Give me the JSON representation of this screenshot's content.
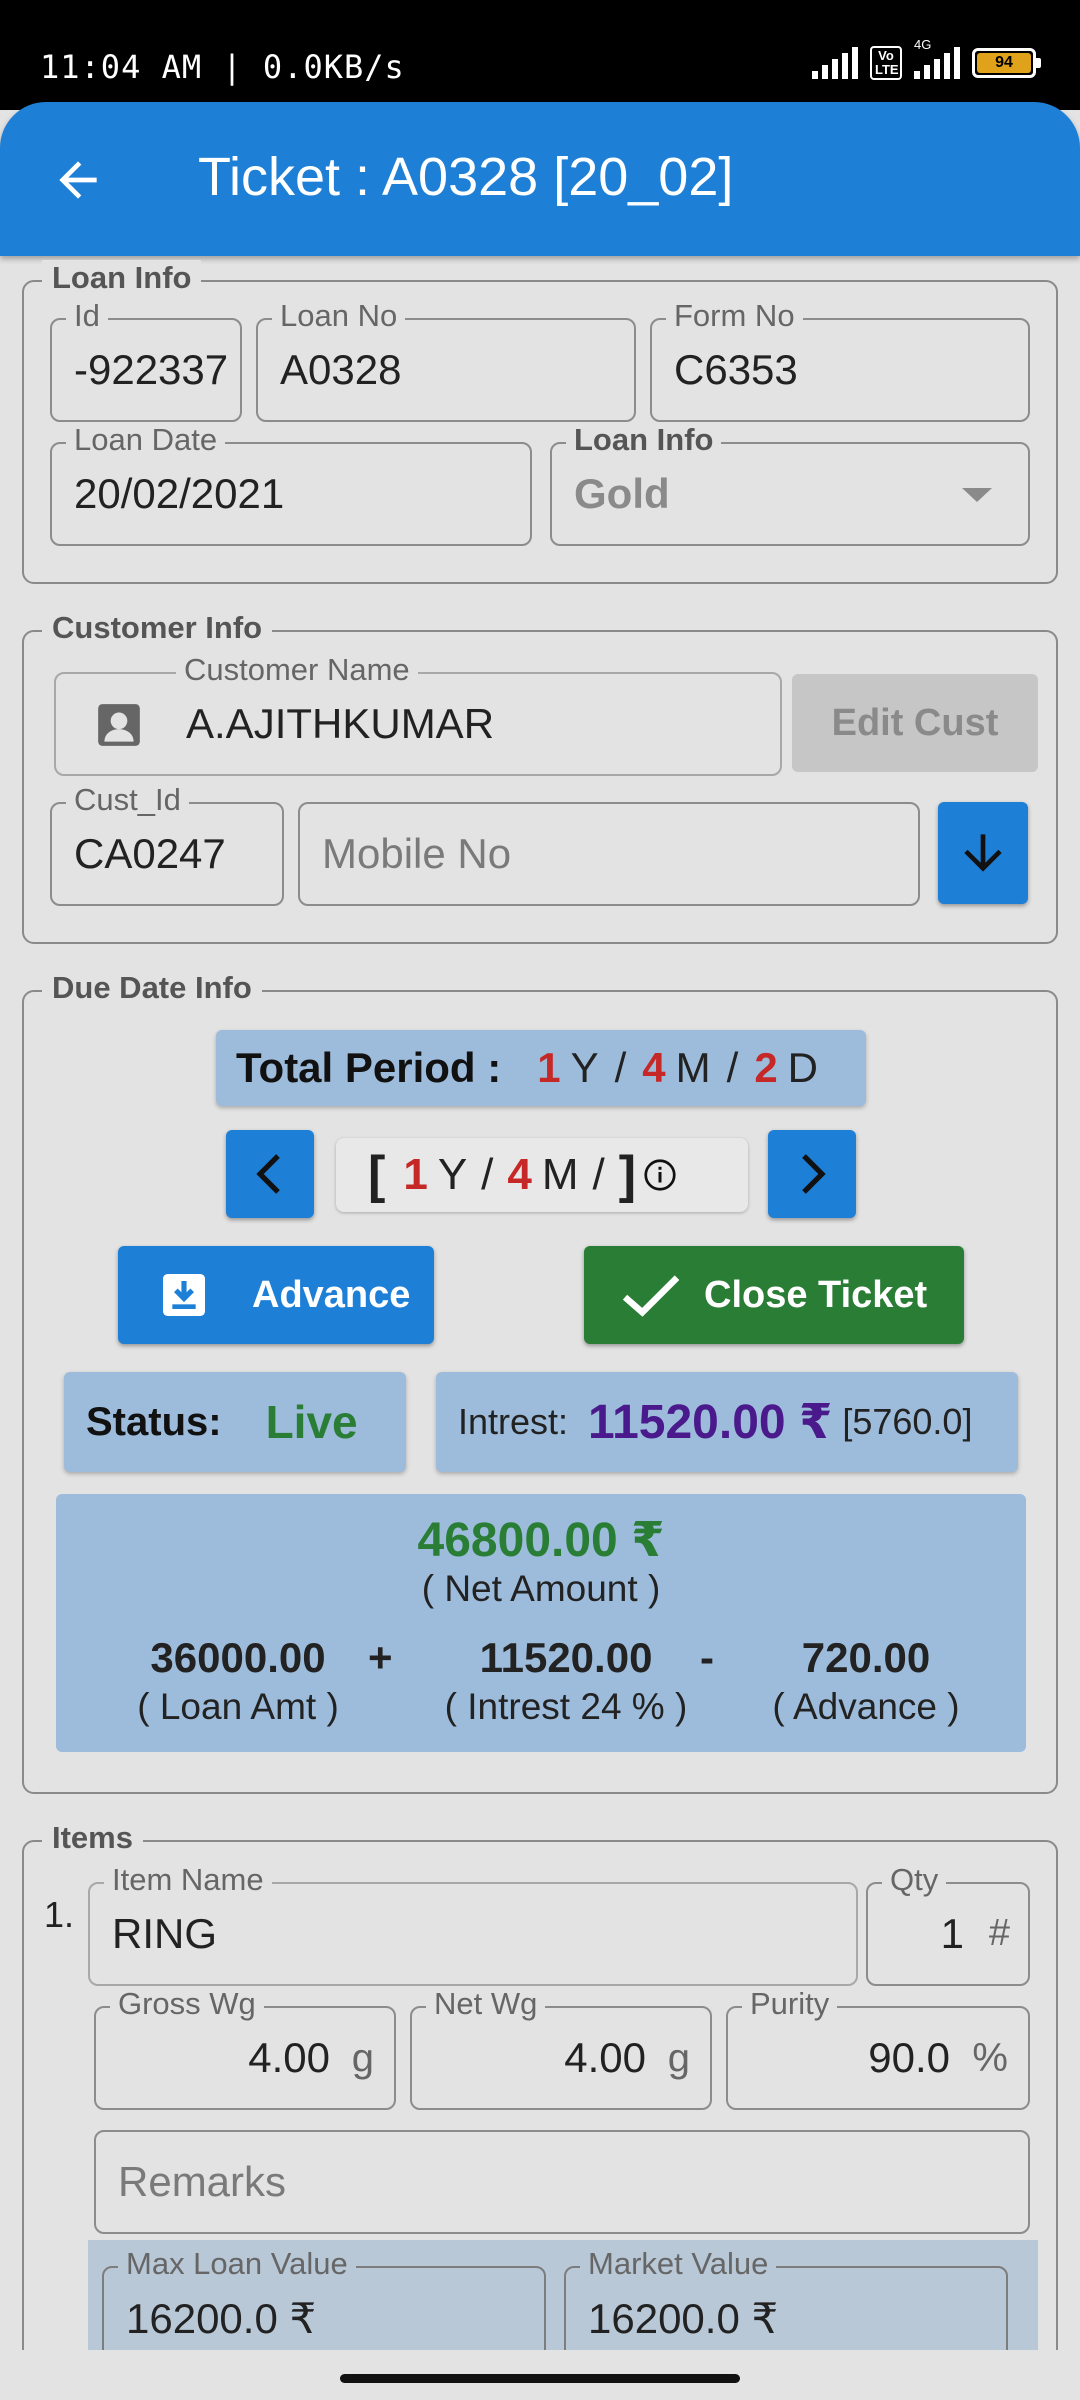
{
  "status_bar": {
    "time": "11:04 AM | 0.0KB/s",
    "network": "4G",
    "volte": "Vo LTE",
    "battery": "94"
  },
  "app_bar": {
    "title": "Ticket : A0328 [20_02]",
    "back_icon": "arrow-left-icon"
  },
  "loan_info": {
    "legend": "Loan Info",
    "id_label": "Id",
    "id_value": "-922337",
    "loan_no_label": "Loan No",
    "loan_no_value": "A0328",
    "form_no_label": "Form No",
    "form_no_value": "C6353",
    "loan_date_label": "Loan Date",
    "loan_date_value": "20/02/2021",
    "loan_type_label": "Loan Info",
    "loan_type_value": "Gold"
  },
  "customer_info": {
    "legend": "Customer Info",
    "name_label": "Customer Name",
    "name_value": "A.AJITHKUMAR",
    "edit_button": "Edit Cust",
    "cust_id_label": "Cust_Id",
    "cust_id_value": "CA0247",
    "mobile_placeholder": "Mobile No"
  },
  "due_date_info": {
    "legend": "Due Date Info",
    "total_period_label": "Total Period :",
    "period_years": "1",
    "period_years_unit": "Y",
    "period_months": "4",
    "period_months_unit": "M",
    "period_days": "2",
    "period_days_unit": "D",
    "sep": "/",
    "selector_open": "[",
    "selector_close": "]",
    "selector_years": "1",
    "selector_months": "4",
    "advance_button": "Advance",
    "close_ticket_button": "Close Ticket",
    "status_label": "Status:",
    "status_value": "Live",
    "interest_label": "Intrest:",
    "interest_value": "11520.00 ₹",
    "interest_bracket": "[5760.0]",
    "net_amount": "46800.00 ₹",
    "net_amount_caption": "( Net Amount )",
    "loan_amt": "36000.00",
    "loan_amt_caption": "( Loan Amt )",
    "plus": "+",
    "interest_amt": "11520.00",
    "interest_amt_caption": "( Intrest 24 % )",
    "minus": "-",
    "advance_amt": "720.00",
    "advance_caption": "( Advance )"
  },
  "items": {
    "legend": "Items",
    "index": "1.",
    "item_name_label": "Item Name",
    "item_name_value": "RING",
    "qty_label": "Qty",
    "qty_value": "1",
    "qty_unit": "#",
    "gross_label": "Gross Wg",
    "gross_value": "4.00",
    "gross_unit": "g",
    "net_label": "Net Wg",
    "net_value": "4.00",
    "net_unit": "g",
    "purity_label": "Purity",
    "purity_value": "90.0",
    "purity_unit": "%",
    "remarks_placeholder": "Remarks",
    "max_loan_label": "Max Loan Value",
    "max_loan_value": "16200.0 ₹",
    "market_label": "Market Value",
    "market_value": "16200.0 ₹"
  },
  "colors": {
    "primary_blue": "#1e7fd6",
    "green": "#2a7d35",
    "chip_blue": "#9dbcdb",
    "red": "#c62828",
    "purple": "#4a1a8c"
  }
}
